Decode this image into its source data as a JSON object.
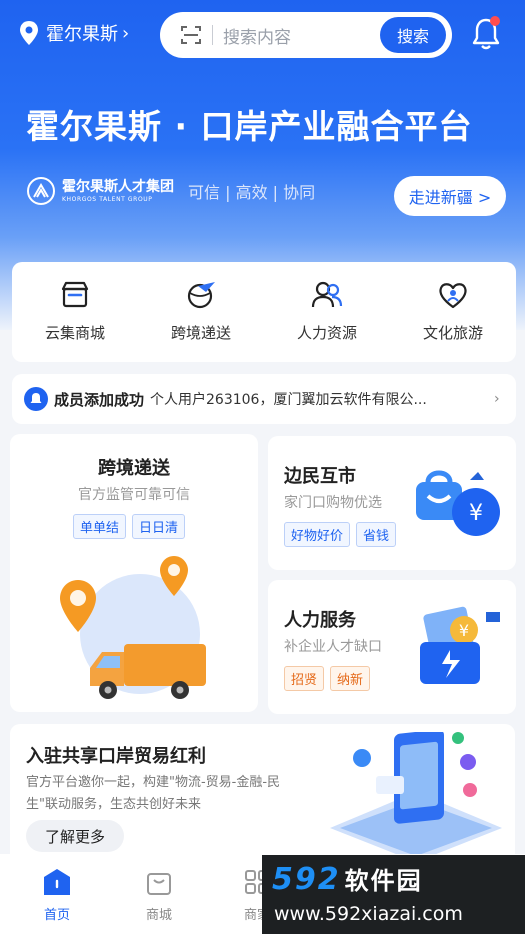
{
  "header": {
    "location": "霍尔果斯",
    "search_placeholder": "搜索内容",
    "search_button": "搜索"
  },
  "hero": {
    "title": "霍尔果斯 · 口岸产业融合平台",
    "brand_cn": "霍尔果斯人才集团",
    "brand_en": "KHORGOS TALENT GROUP",
    "tags": "可信 | 高效 | 协同",
    "cta": "走进新疆 >"
  },
  "services": [
    {
      "label": "云集商城",
      "icon": "store-icon"
    },
    {
      "label": "跨境递送",
      "icon": "globe-plane-icon"
    },
    {
      "label": "人力资源",
      "icon": "people-icon"
    },
    {
      "label": "文化旅游",
      "icon": "heart-person-icon"
    }
  ],
  "notice": {
    "title": "成员添加成功",
    "message": "个人用户263106，厦门翼加云软件有限公..."
  },
  "cards": {
    "delivery": {
      "title": "跨境递送",
      "subtitle": "官方监管可靠可信",
      "tags": [
        "单单结",
        "日日清"
      ]
    },
    "border_trade": {
      "title": "边民互市",
      "subtitle": "家门口购物优选",
      "tags": [
        "好物好价",
        "省钱"
      ]
    },
    "hr": {
      "title": "人力服务",
      "subtitle": "补企业人才缺口",
      "tags": [
        "招贤",
        "纳新"
      ]
    },
    "join": {
      "title": "入驻共享口岸贸易红利",
      "subtitle": "官方平台邀你一起，构建\"物流-贸易-金融-民生\"联动服务，生态共创好未来",
      "button": "了解更多"
    }
  },
  "tabbar": [
    {
      "label": "首页",
      "active": true
    },
    {
      "label": "商城",
      "active": false
    },
    {
      "label": "商家",
      "active": false
    }
  ],
  "watermark": {
    "brand": "592",
    "brand_cn": "软件园",
    "url": "www.592xiazai.com"
  },
  "colors": {
    "primary": "#1f63f0",
    "orange": "#f59a23",
    "badge": "#ff4d4f"
  }
}
